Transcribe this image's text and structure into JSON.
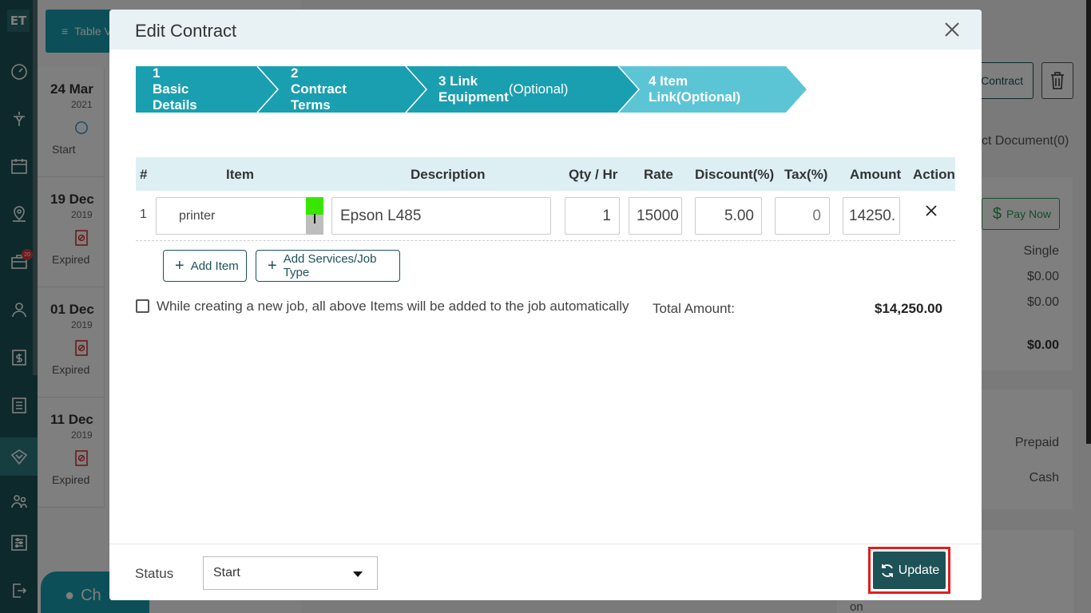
{
  "app": {
    "logo": "ET"
  },
  "nav": {
    "badge_count": "20"
  },
  "background": {
    "table_view_label": "Table V",
    "dates": [
      {
        "date": "24 Mar",
        "year": "2021",
        "status": "Start"
      },
      {
        "date": "19 Dec",
        "year": "2019",
        "status": "Expired"
      },
      {
        "date": "01 Dec",
        "year": "2019",
        "status": "Expired"
      },
      {
        "date": "11 Dec",
        "year": "2019",
        "status": "Expired"
      }
    ],
    "contract_btn": "Contract",
    "doc_tab": "ct Document(0)",
    "pay_now": "Pay Now",
    "summary": [
      "Single",
      "$0.00",
      "$0.00",
      "$0.00"
    ],
    "payment": [
      "Prepaid",
      "Cash"
    ],
    "footer_text": "on",
    "chat": "Ch"
  },
  "modal": {
    "title": "Edit Contract",
    "steps": [
      {
        "label": "1 Basic Details",
        "opt": ""
      },
      {
        "label": "2 Contract Terms",
        "opt": ""
      },
      {
        "label": "3 Link Equipment",
        "opt": " (Optional)"
      },
      {
        "label": "4 Item Link(Optional)",
        "opt": ""
      }
    ],
    "table": {
      "headers": [
        "#",
        "Item",
        "Description",
        "Qty / Hr",
        "Rate",
        "Discount(%)",
        "Tax(%)",
        "Amount",
        "Action"
      ],
      "row": {
        "num": "1",
        "item": "printer",
        "description": "Epson L485",
        "qty": "1",
        "rate": "15000",
        "discount": "5.00",
        "tax": "0",
        "amount": "14250."
      }
    },
    "add_item": "Add Item",
    "add_services": "Add Services/Job Type",
    "auto_add_label": "While creating a new job, all above Items will be added to the job automatically",
    "total_label": "Total Amount:",
    "total_value": "$14,250.00",
    "status_label": "Status",
    "status_value": "Start",
    "update_label": "Update"
  },
  "colors": {
    "teal_dark": "#1d5257",
    "step_teal": "#1a9fb0",
    "step_active": "#5cc5d5",
    "highlight_red": "#e31d1d"
  }
}
